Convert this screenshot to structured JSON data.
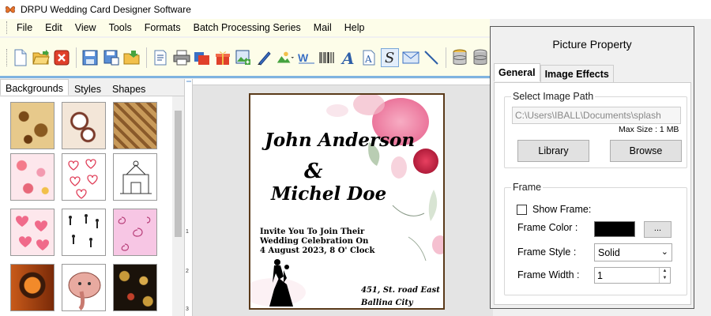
{
  "window": {
    "title": "DRPU Wedding Card Designer Software",
    "icon": "butterfly-icon"
  },
  "menu": [
    "File",
    "Edit",
    "View",
    "Tools",
    "Formats",
    "Batch Processing Series",
    "Mail",
    "Help"
  ],
  "toolbar": {
    "icons": [
      "new-file-icon",
      "open-folder-icon",
      "close-icon",
      "save-icon",
      "save-as-icon",
      "export-icon",
      "properties-icon",
      "print-icon",
      "print-preview-icon",
      "gift-icon",
      "image-add-icon",
      "pen-icon",
      "picture-icon",
      "watermark-icon",
      "barcode-icon",
      "text-icon",
      "text-box-icon",
      "signature-icon",
      "mail-icon",
      "line-icon",
      "database-icon",
      "database2-icon"
    ]
  },
  "left_panel": {
    "tabs": [
      "Backgrounds",
      "Styles",
      "Shapes"
    ],
    "active_tab": "Backgrounds",
    "thumbnails": [
      "paisley-gold",
      "paisley-sketch",
      "brown-pattern",
      "pink-flowers",
      "hearts-outline",
      "temple-sketch",
      "pink-hearts",
      "couple-figures",
      "pink-swirls",
      "ganesha-orange",
      "elephant-ganesha",
      "gold-black-floral"
    ]
  },
  "ruler": {
    "ticks": [
      "1",
      "2",
      "3"
    ]
  },
  "card": {
    "name1": "John Anderson",
    "amp": "&",
    "name2": "Michel Doe",
    "invite_lines": [
      "Invite You To Join Their",
      "Wedding Celebration On",
      "4 August 2023, 8 O' Clock"
    ],
    "address_lines": [
      "451, St. road East",
      "Ballina City"
    ]
  },
  "picture_property": {
    "title": "Picture Property",
    "tabs": [
      "General",
      "Image Effects"
    ],
    "active_tab": "General",
    "select_image_path_label": "Select Image Path",
    "image_path": "C:\\Users\\IBALL\\Documents\\splash",
    "max_size": "Max Size : 1 MB",
    "library_button": "Library",
    "browse_button": "Browse",
    "frame_group_label": "Frame",
    "show_frame_label": "Show Frame:",
    "show_frame_checked": false,
    "frame_color_label": "Frame Color :",
    "frame_color": "#000000",
    "color_picker_button": "...",
    "frame_style_label": "Frame Style :",
    "frame_style_value": "Solid",
    "frame_width_label": "Frame Width :",
    "frame_width_value": "1"
  },
  "colors": {
    "menu_bg": "#fdfde9",
    "accent_blue": "#7fb3e0",
    "card_border": "#5a3a1a"
  }
}
